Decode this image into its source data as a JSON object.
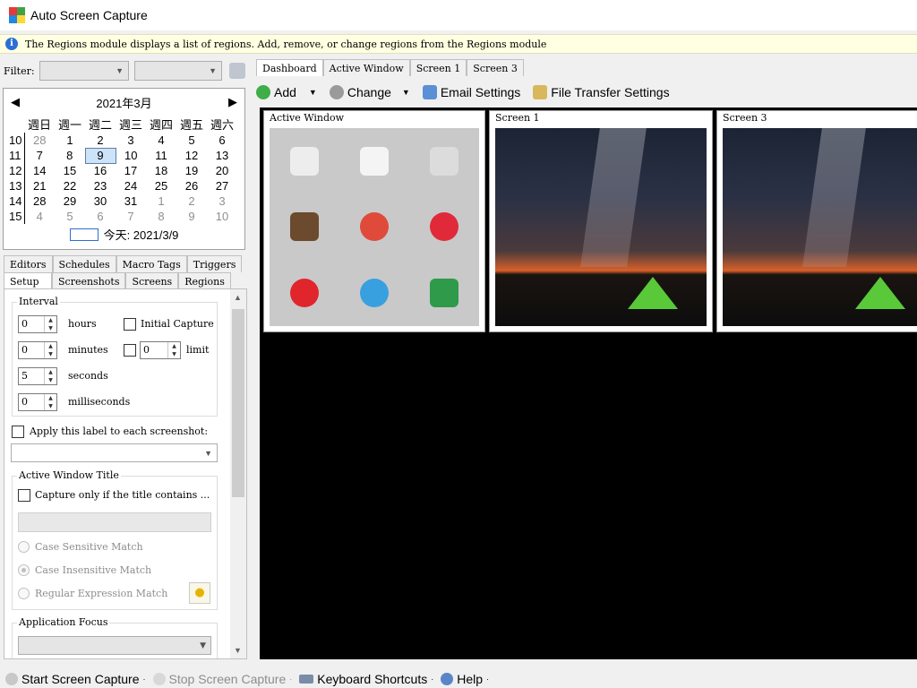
{
  "window": {
    "title": "Auto Screen Capture"
  },
  "infobar": {
    "text": "The Regions module displays a list of regions. Add, remove, or change regions from the Regions module"
  },
  "filter": {
    "label": "Filter:"
  },
  "calendar": {
    "month_label": "2021年3月",
    "weekdays": [
      "週日",
      "週一",
      "週二",
      "週三",
      "週四",
      "週五",
      "週六"
    ],
    "weeks": [
      {
        "wk": "10",
        "days": [
          "28",
          "1",
          "2",
          "3",
          "4",
          "5",
          "6"
        ]
      },
      {
        "wk": "11",
        "days": [
          "7",
          "8",
          "9",
          "10",
          "11",
          "12",
          "13"
        ]
      },
      {
        "wk": "12",
        "days": [
          "14",
          "15",
          "16",
          "17",
          "18",
          "19",
          "20"
        ]
      },
      {
        "wk": "13",
        "days": [
          "21",
          "22",
          "23",
          "24",
          "25",
          "26",
          "27"
        ]
      },
      {
        "wk": "14",
        "days": [
          "28",
          "29",
          "30",
          "31",
          "1",
          "2",
          "3"
        ]
      },
      {
        "wk": "15",
        "days": [
          "4",
          "5",
          "6",
          "7",
          "8",
          "9",
          "10"
        ]
      }
    ],
    "today_label": "今天: 2021/3/9"
  },
  "left_tabs": {
    "row1": [
      "Editors",
      "Schedules",
      "Macro Tags",
      "Triggers"
    ],
    "row2": [
      "Setup",
      "Screenshots",
      "Screens",
      "Regions"
    ]
  },
  "setup": {
    "interval_title": "Interval",
    "hours_value": "0",
    "hours_label": "hours",
    "minutes_value": "0",
    "minutes_label": "minutes",
    "seconds_value": "5",
    "seconds_label": "seconds",
    "ms_value": "0",
    "ms_label": "milliseconds",
    "initial_capture": "Initial Capture",
    "limit_value": "0",
    "limit_label": "limit",
    "apply_label": "Apply this label to each screenshot:",
    "awt_title": "Active Window Title",
    "capture_only": "Capture only if the title contains ...",
    "case_sensitive": "Case Sensitive Match",
    "case_insensitive": "Case Insensitive Match",
    "regex": "Regular Expression Match",
    "app_focus_title": "Application Focus"
  },
  "main_tabs": [
    "Dashboard",
    "Active Window",
    "Screen 1",
    "Screen 3"
  ],
  "toolbar": {
    "add": "Add",
    "change": "Change",
    "email": "Email Settings",
    "file_transfer": "File Transfer Settings"
  },
  "panes": {
    "p1": "Active Window",
    "p2": "Screen 1",
    "p3": "Screen 3"
  },
  "statusbar": {
    "start": "Start Screen Capture",
    "stop": "Stop Screen Capture",
    "shortcuts": "Keyboard Shortcuts",
    "help": "Help"
  },
  "colors": {
    "accent": "#2f6ed0",
    "info_bg": "#ffffe1",
    "viewer_bg": "#000000",
    "tent": "#59c93a"
  }
}
